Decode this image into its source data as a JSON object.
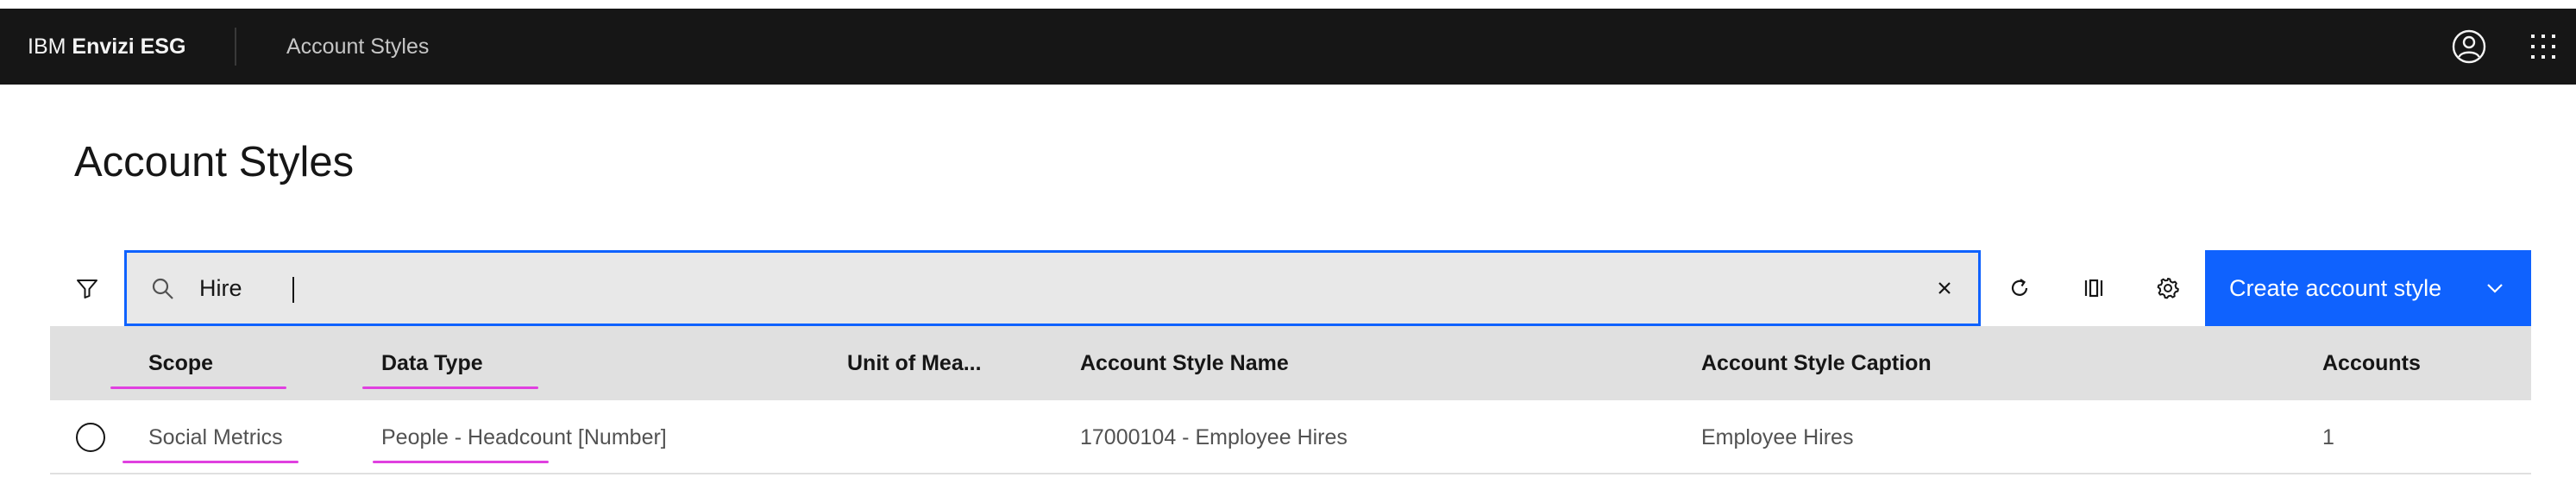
{
  "header": {
    "brand_prefix": "IBM",
    "brand_name": "Envizi ESG",
    "app_name": "Account Styles",
    "icons": [
      "user-avatar-icon",
      "app-switcher-icon"
    ]
  },
  "page": {
    "title": "Account Styles"
  },
  "toolbar": {
    "search_value": "Hire",
    "create_label": "Create account style",
    "icons": [
      "filter-icon",
      "search-icon",
      "close-icon",
      "refresh-icon",
      "columns-icon",
      "settings-icon",
      "chevron-down-icon"
    ]
  },
  "table": {
    "columns": [
      "Scope",
      "Data Type",
      "Unit of Mea...",
      "Account Style Name",
      "Account Style Caption",
      "Accounts"
    ],
    "rows": [
      {
        "scope": "Social Metrics",
        "data_type": "People - Headcount [Number]",
        "unit": "",
        "name": "17000104 - Employee Hires",
        "caption": "Employee Hires",
        "accounts": "1"
      }
    ]
  },
  "colors": {
    "header_bg": "#161616",
    "primary": "#0f62fe",
    "table_header_bg": "#e0e0e0",
    "annotation": "#e040e0"
  }
}
